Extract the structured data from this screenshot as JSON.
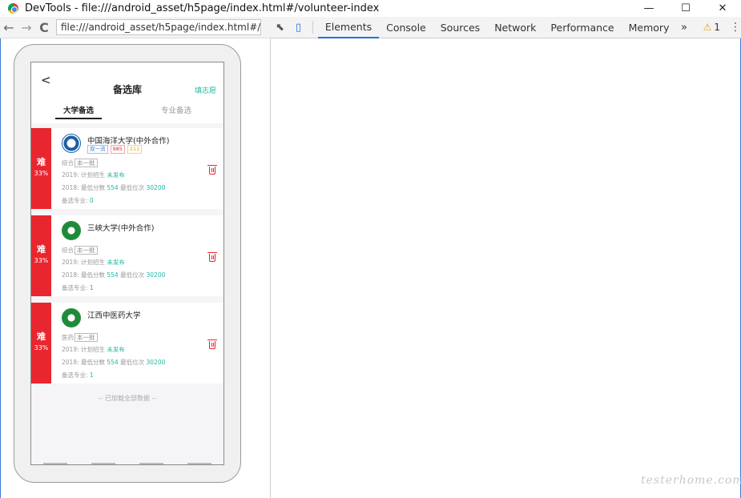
{
  "window": {
    "title": "DevTools - file:///android_asset/h5page/index.html#/volunteer-index",
    "controls": {
      "minimize": "—",
      "maximize": "☐",
      "close": "✕"
    }
  },
  "address_bar": {
    "url": "file:///android_asset/h5page/index.html#/volu",
    "back_icon": "←",
    "forward_icon": "→",
    "reload_icon": "C"
  },
  "devtools": {
    "tabs": [
      "Elements",
      "Console",
      "Sources",
      "Network",
      "Performance",
      "Memory"
    ],
    "active_tab": "Elements",
    "more_label": "»",
    "warning_count": "1",
    "warning_icon": "⚠",
    "kebab": "⋮",
    "inspect_icon": "⬉",
    "device_icon": "▯"
  },
  "app": {
    "header": {
      "back": "<",
      "title": "备选库",
      "action": "填志愿"
    },
    "tabs": [
      "大学备选",
      "专业备选"
    ],
    "cards": [
      {
        "difficulty": "难",
        "probability": "33%",
        "name": "中国海洋大学(中外合作)",
        "badges": [
          "双一流",
          "985",
          "211"
        ],
        "type": "综合",
        "batch": "本一批",
        "line2019_prefix": "2019:  计划招生 ",
        "line2019_value": "未发布",
        "line2018_prefix": "2018:  最低分数 ",
        "line2018_score": "554",
        "line2018_mid": " 最低位次 ",
        "line2018_rank": "30200",
        "majors_prefix": "备选专业: ",
        "majors_count": "0"
      },
      {
        "difficulty": "难",
        "probability": "33%",
        "name": "三峡大学(中外合作)",
        "badges": [],
        "type": "综合",
        "batch": "本一批",
        "line2019_prefix": "2019:  计划招生 ",
        "line2019_value": "未发布",
        "line2018_prefix": "2018:  最低分数 ",
        "line2018_score": "554",
        "line2018_mid": " 最低位次 ",
        "line2018_rank": "30200",
        "majors_prefix": "备选专业: ",
        "majors_count": "1"
      },
      {
        "difficulty": "难",
        "probability": "33%",
        "name": "江西中医药大学",
        "badges": [],
        "type": "医药",
        "batch": "本一批",
        "line2019_prefix": "2019:  计划招生 ",
        "line2019_value": "未发布",
        "line2018_prefix": "2018:  最低分数 ",
        "line2018_score": "554",
        "line2018_mid": " 最低位次 ",
        "line2018_rank": "30200",
        "majors_prefix": "备选专业: ",
        "majors_count": "1"
      }
    ],
    "footer": "-- 已加载全部数据 --"
  },
  "watermark": "testerhome.com",
  "colors": {
    "accent": "#1fb7a4",
    "danger": "#e8262f",
    "devtools_blue": "#1a73e8"
  }
}
